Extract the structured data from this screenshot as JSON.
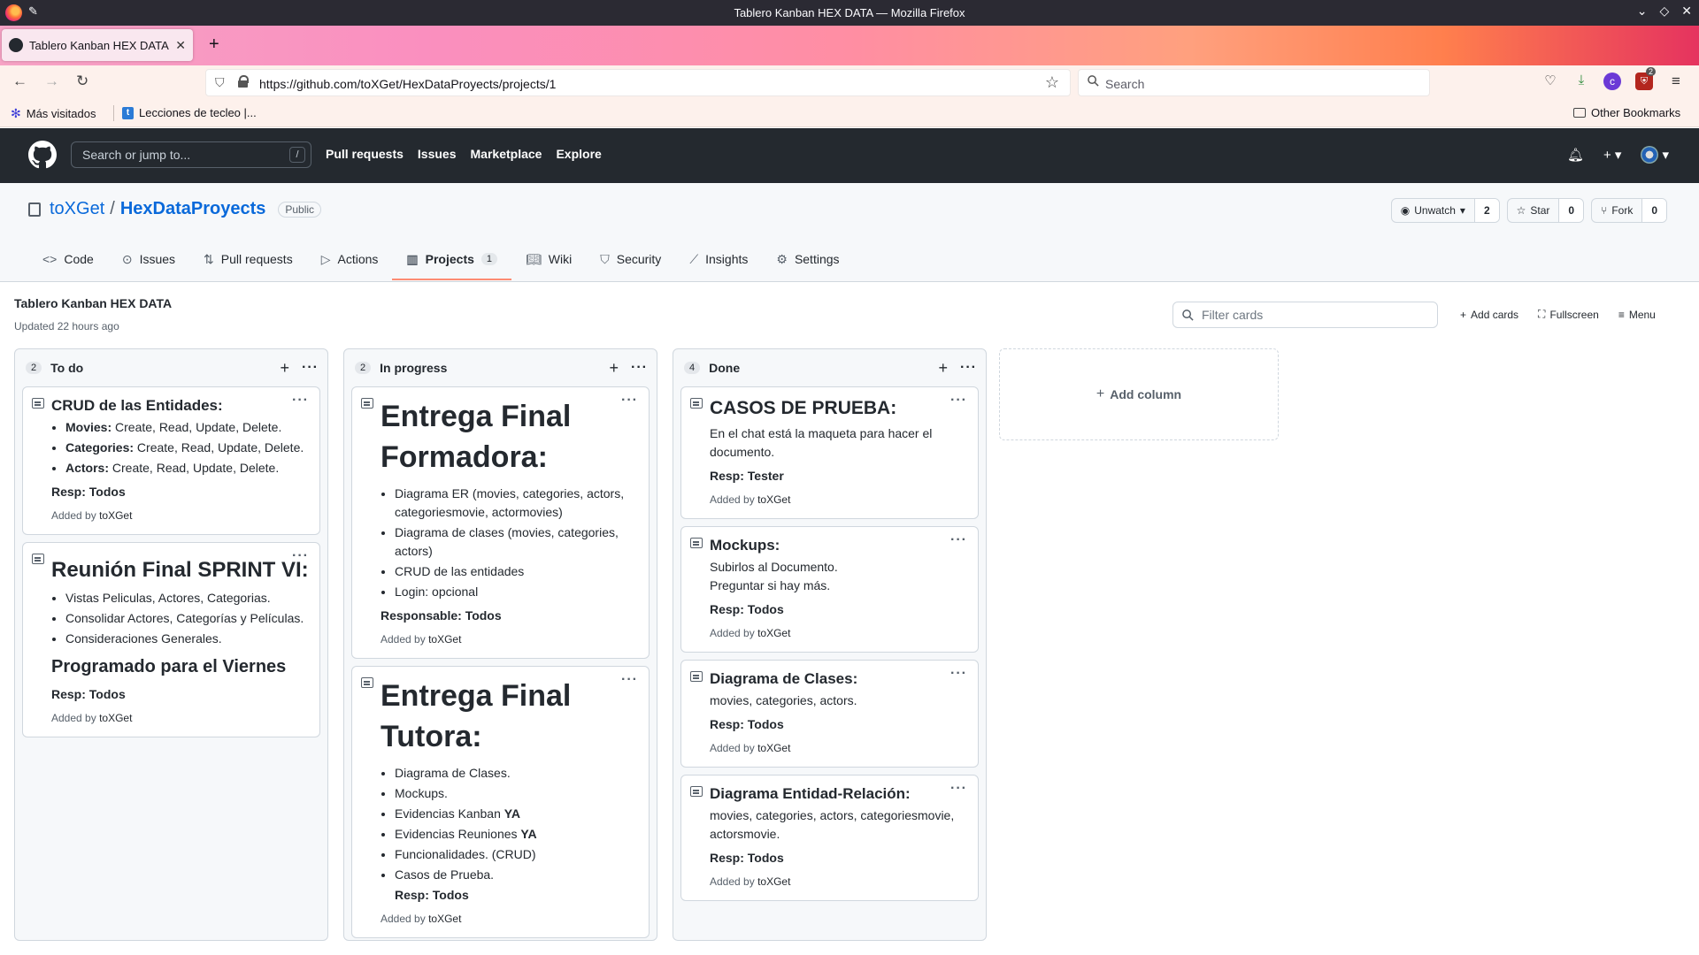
{
  "window": {
    "title": "Tablero Kanban HEX DATA — Mozilla Firefox"
  },
  "browser": {
    "tab_title": "Tablero Kanban HEX DATA",
    "url": "https://github.com/toXGet/HexDataProyects/projects/1",
    "search_placeholder": "Search",
    "bookmarks": [
      "Más visitados",
      "Lecciones de tecleo |...",
      "Other Bookmarks"
    ],
    "ext_badge": "2"
  },
  "github": {
    "search_placeholder": "Search or jump to...",
    "search_shortcut": "/",
    "nav": [
      "Pull requests",
      "Issues",
      "Marketplace",
      "Explore"
    ]
  },
  "repo": {
    "owner": "toXGet",
    "separator": "/",
    "name": "HexDataProyects",
    "visibility": "Public",
    "unwatch_label": "Unwatch",
    "watch_count": "2",
    "star_label": "Star",
    "star_count": "0",
    "fork_label": "Fork",
    "fork_count": "0",
    "tabs": [
      {
        "label": "Code"
      },
      {
        "label": "Issues"
      },
      {
        "label": "Pull requests"
      },
      {
        "label": "Actions"
      },
      {
        "label": "Projects",
        "counter": "1"
      },
      {
        "label": "Wiki"
      },
      {
        "label": "Security"
      },
      {
        "label": "Insights"
      },
      {
        "label": "Settings"
      }
    ]
  },
  "project": {
    "title": "Tablero Kanban HEX DATA",
    "updated": "Updated 22 hours ago",
    "filter_placeholder": "Filter cards",
    "add_cards": "Add cards",
    "fullscreen": "Fullscreen",
    "menu": "Menu",
    "add_column": "Add column"
  },
  "columns": [
    {
      "name": "To do",
      "count": "2",
      "cards": [
        {
          "heading": "CRUD de las Entidades:",
          "items": [
            {
              "b": "Movies:",
              "t": " Create, Read, Update, Delete."
            },
            {
              "b": "Categories:",
              "t": " Create, Read, Update, Delete."
            },
            {
              "b": "Actors:",
              "t": " Create, Read, Update, Delete."
            }
          ],
          "resp": "Resp: Todos",
          "added_prefix": "Added by",
          "added_by": "toXGet"
        },
        {
          "heading": "Reunión Final SPRINT VI:",
          "items": [
            "Vistas Peliculas, Actores, Categorias.",
            "Consolidar Actores, Categorías y Películas.",
            "Consideraciones Generales."
          ],
          "subheading": "Programado para el Viernes",
          "resp": "Resp: Todos",
          "added_prefix": "Added by",
          "added_by": "toXGet"
        }
      ]
    },
    {
      "name": "In progress",
      "count": "2",
      "cards": [
        {
          "heading": "Entrega Final Formadora:",
          "items": [
            "Diagrama ER (movies, categories, actors, categoriesmovie, actormovies)",
            "Diagrama de clases (movies, categories, actors)",
            "CRUD de las entidades",
            "Login: opcional"
          ],
          "resp": "Responsable: Todos",
          "added_prefix": "Added by",
          "added_by": "toXGet"
        },
        {
          "heading": "Entrega Final Tutora:",
          "items": [
            {
              "t": "Diagrama de Clases.",
              "b": ""
            },
            {
              "t": "Mockups.",
              "b": ""
            },
            {
              "t": "Evidencias Kanban ",
              "b": "YA"
            },
            {
              "t": "Evidencias Reuniones ",
              "b": "YA"
            },
            {
              "t": "Funcionalidades. (CRUD)",
              "b": ""
            },
            {
              "t": "Casos de Prueba.",
              "b": ""
            }
          ],
          "resp": "Resp: Todos",
          "added_prefix": "Added by",
          "added_by": "toXGet"
        }
      ]
    },
    {
      "name": "Done",
      "count": "4",
      "cards": [
        {
          "heading": "CASOS DE PRUEBA:",
          "lines": [
            "En el chat está la maqueta para hacer el documento."
          ],
          "resp": "Resp: Tester",
          "added_prefix": "Added by",
          "added_by": "toXGet"
        },
        {
          "heading": "Mockups:",
          "lines": [
            "Subirlos al Documento.",
            "Preguntar si hay más."
          ],
          "resp": "Resp: Todos",
          "added_prefix": "Added by",
          "added_by": "toXGet"
        },
        {
          "heading": "Diagrama de Clases:",
          "lines": [
            "movies, categories, actors."
          ],
          "resp": "Resp: Todos",
          "added_prefix": "Added by",
          "added_by": "toXGet"
        },
        {
          "heading": "Diagrama Entidad-Relación:",
          "lines": [
            "movies, categories, actors, categoriesmovie, actorsmovie."
          ],
          "resp": "Resp: Todos",
          "added_prefix": "Added by",
          "added_by": "toXGet"
        }
      ]
    }
  ]
}
